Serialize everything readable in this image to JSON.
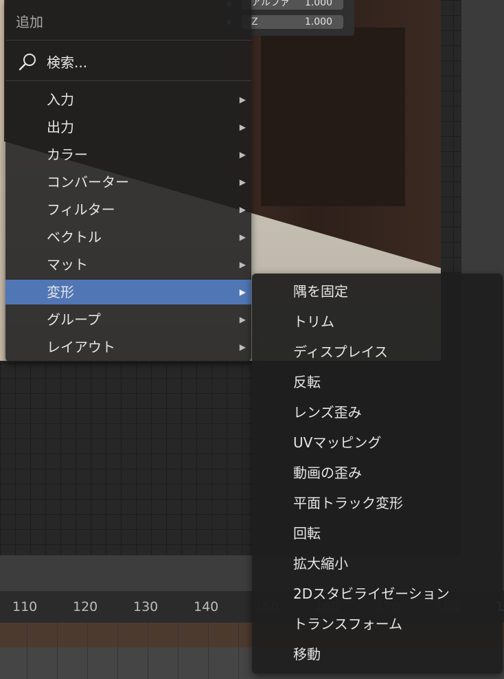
{
  "node": {
    "field1_label": "アルファ",
    "field1_value": "1.000",
    "field2_label": "Z",
    "field2_value": "1.000"
  },
  "timeline": {
    "ticks": [
      "110",
      "120",
      "130",
      "140",
      "150",
      "160",
      "170",
      "180",
      "1"
    ]
  },
  "add_menu": {
    "title": "追加",
    "search_label": "検索...",
    "items": [
      {
        "label": "入力",
        "active": false
      },
      {
        "label": "出力",
        "active": false
      },
      {
        "label": "カラー",
        "active": false
      },
      {
        "label": "コンバーター",
        "active": false
      },
      {
        "label": "フィルター",
        "active": false
      },
      {
        "label": "ベクトル",
        "active": false
      },
      {
        "label": "マット",
        "active": false
      },
      {
        "label": "変形",
        "active": true
      },
      {
        "label": "グループ",
        "active": false
      },
      {
        "label": "レイアウト",
        "active": false
      }
    ],
    "arrow_glyph": "▶"
  },
  "submenu": {
    "items": [
      "隅を固定",
      "トリム",
      "ディスプレイス",
      "反転",
      "レンズ歪み",
      "UVマッピング",
      "動画の歪み",
      "平面トラック変形",
      "回転",
      "拡大縮小",
      "2Dスタビライゼーション",
      "トランスフォーム",
      "移動"
    ]
  },
  "colors": {
    "active_item": "#5176b5",
    "menu_bg": "#1e1e1e"
  }
}
